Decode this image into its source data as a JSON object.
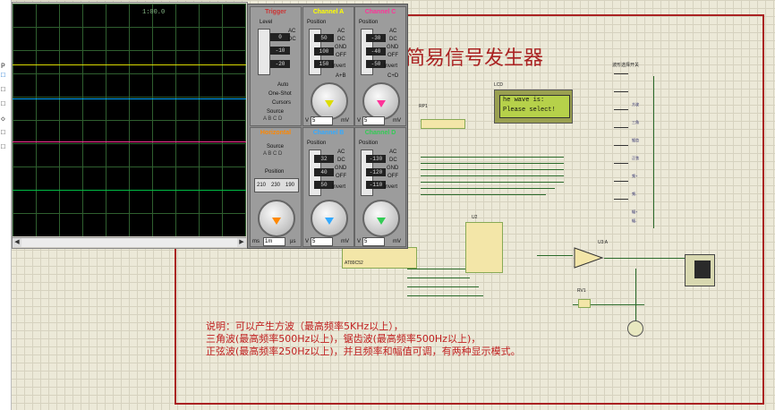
{
  "scope": {
    "timestamp": "1:00.0",
    "traces": [
      {
        "name": "Channel A",
        "color": "#d8d800"
      },
      {
        "name": "Channel B",
        "color": "#00aaff"
      },
      {
        "name": "Channel C",
        "color": "#ff3399"
      },
      {
        "name": "Channel D",
        "color": "#00bb44"
      }
    ]
  },
  "panel": {
    "trigger": {
      "title": "Trigger",
      "level_label": "Level",
      "level_values": [
        "0",
        "-10",
        "-20"
      ],
      "ac": "AC",
      "dc": "DC",
      "off": "OFF",
      "auto": "Auto",
      "one_shot": "One-Shot",
      "cursors": "Cursors",
      "source": "Source",
      "source_letters": "A B C D"
    },
    "channel_a": {
      "title": "Channel A",
      "color": "#ffff00",
      "position": "Position",
      "values": [
        "50",
        "100",
        "150"
      ],
      "ac": "AC",
      "dc": "DC",
      "gnd": "GND",
      "off": "OFF",
      "invert": "Invert",
      "a_plus_b": "A+B",
      "v": "V",
      "unit": "mV",
      "div": "5"
    },
    "channel_c": {
      "title": "Channel C",
      "color": "#ff3399",
      "position": "Position",
      "values": [
        "-30",
        "-40",
        "-50"
      ],
      "ac": "AC",
      "dc": "DC",
      "gnd": "GND",
      "off": "OFF",
      "invert": "Invert",
      "c_plus_d": "C+D",
      "v": "V",
      "unit": "mV",
      "div": "5"
    },
    "horizontal": {
      "title": "Horizontal",
      "color": "#ff8800",
      "source": "Source",
      "source_letters": "A B C D",
      "position": "Position",
      "values": [
        "210",
        "230",
        "190"
      ],
      "ms": "ms",
      "us": "µs",
      "div": "1m"
    },
    "channel_b": {
      "title": "Channel B",
      "color": "#33aaff",
      "position": "Position",
      "values": [
        "32",
        "40",
        "50"
      ],
      "ac": "AC",
      "dc": "DC",
      "gnd": "GND",
      "off": "OFF",
      "invert": "Invert",
      "v": "V",
      "unit": "mV",
      "div": "5"
    },
    "channel_d": {
      "title": "Channel D",
      "color": "#33cc55",
      "position": "Position",
      "values": [
        "-130",
        "-120",
        "-110"
      ],
      "ac": "AC",
      "dc": "DC",
      "gnd": "GND",
      "off": "OFF",
      "invert": "Invert",
      "v": "V",
      "unit": "mV",
      "div": "5"
    }
  },
  "schematic": {
    "title": "简易信号发生器",
    "lcd_label": "LCD",
    "lcd_line1": "he wave is:",
    "lcd_line2": "Please select!",
    "rp1": "RP1",
    "u2": "U2",
    "u3": "U3:A",
    "rv1": "RV1",
    "cpu": "AT89C52",
    "switch_bank": "波形选择开关",
    "button_labels": [
      "方波",
      "三角",
      "锯齿",
      "正弦",
      "频+",
      "频-",
      "幅+",
      "幅-"
    ],
    "description": [
      "说明：可以产生方波（最高频率5KHz以上），",
      "三角波(最高频率500Hz以上)，锯齿波(最高频率500Hz以上)，",
      "正弦波(最高频率250Hz以上)，并且频率和幅值可调，有两种显示模式。"
    ]
  }
}
